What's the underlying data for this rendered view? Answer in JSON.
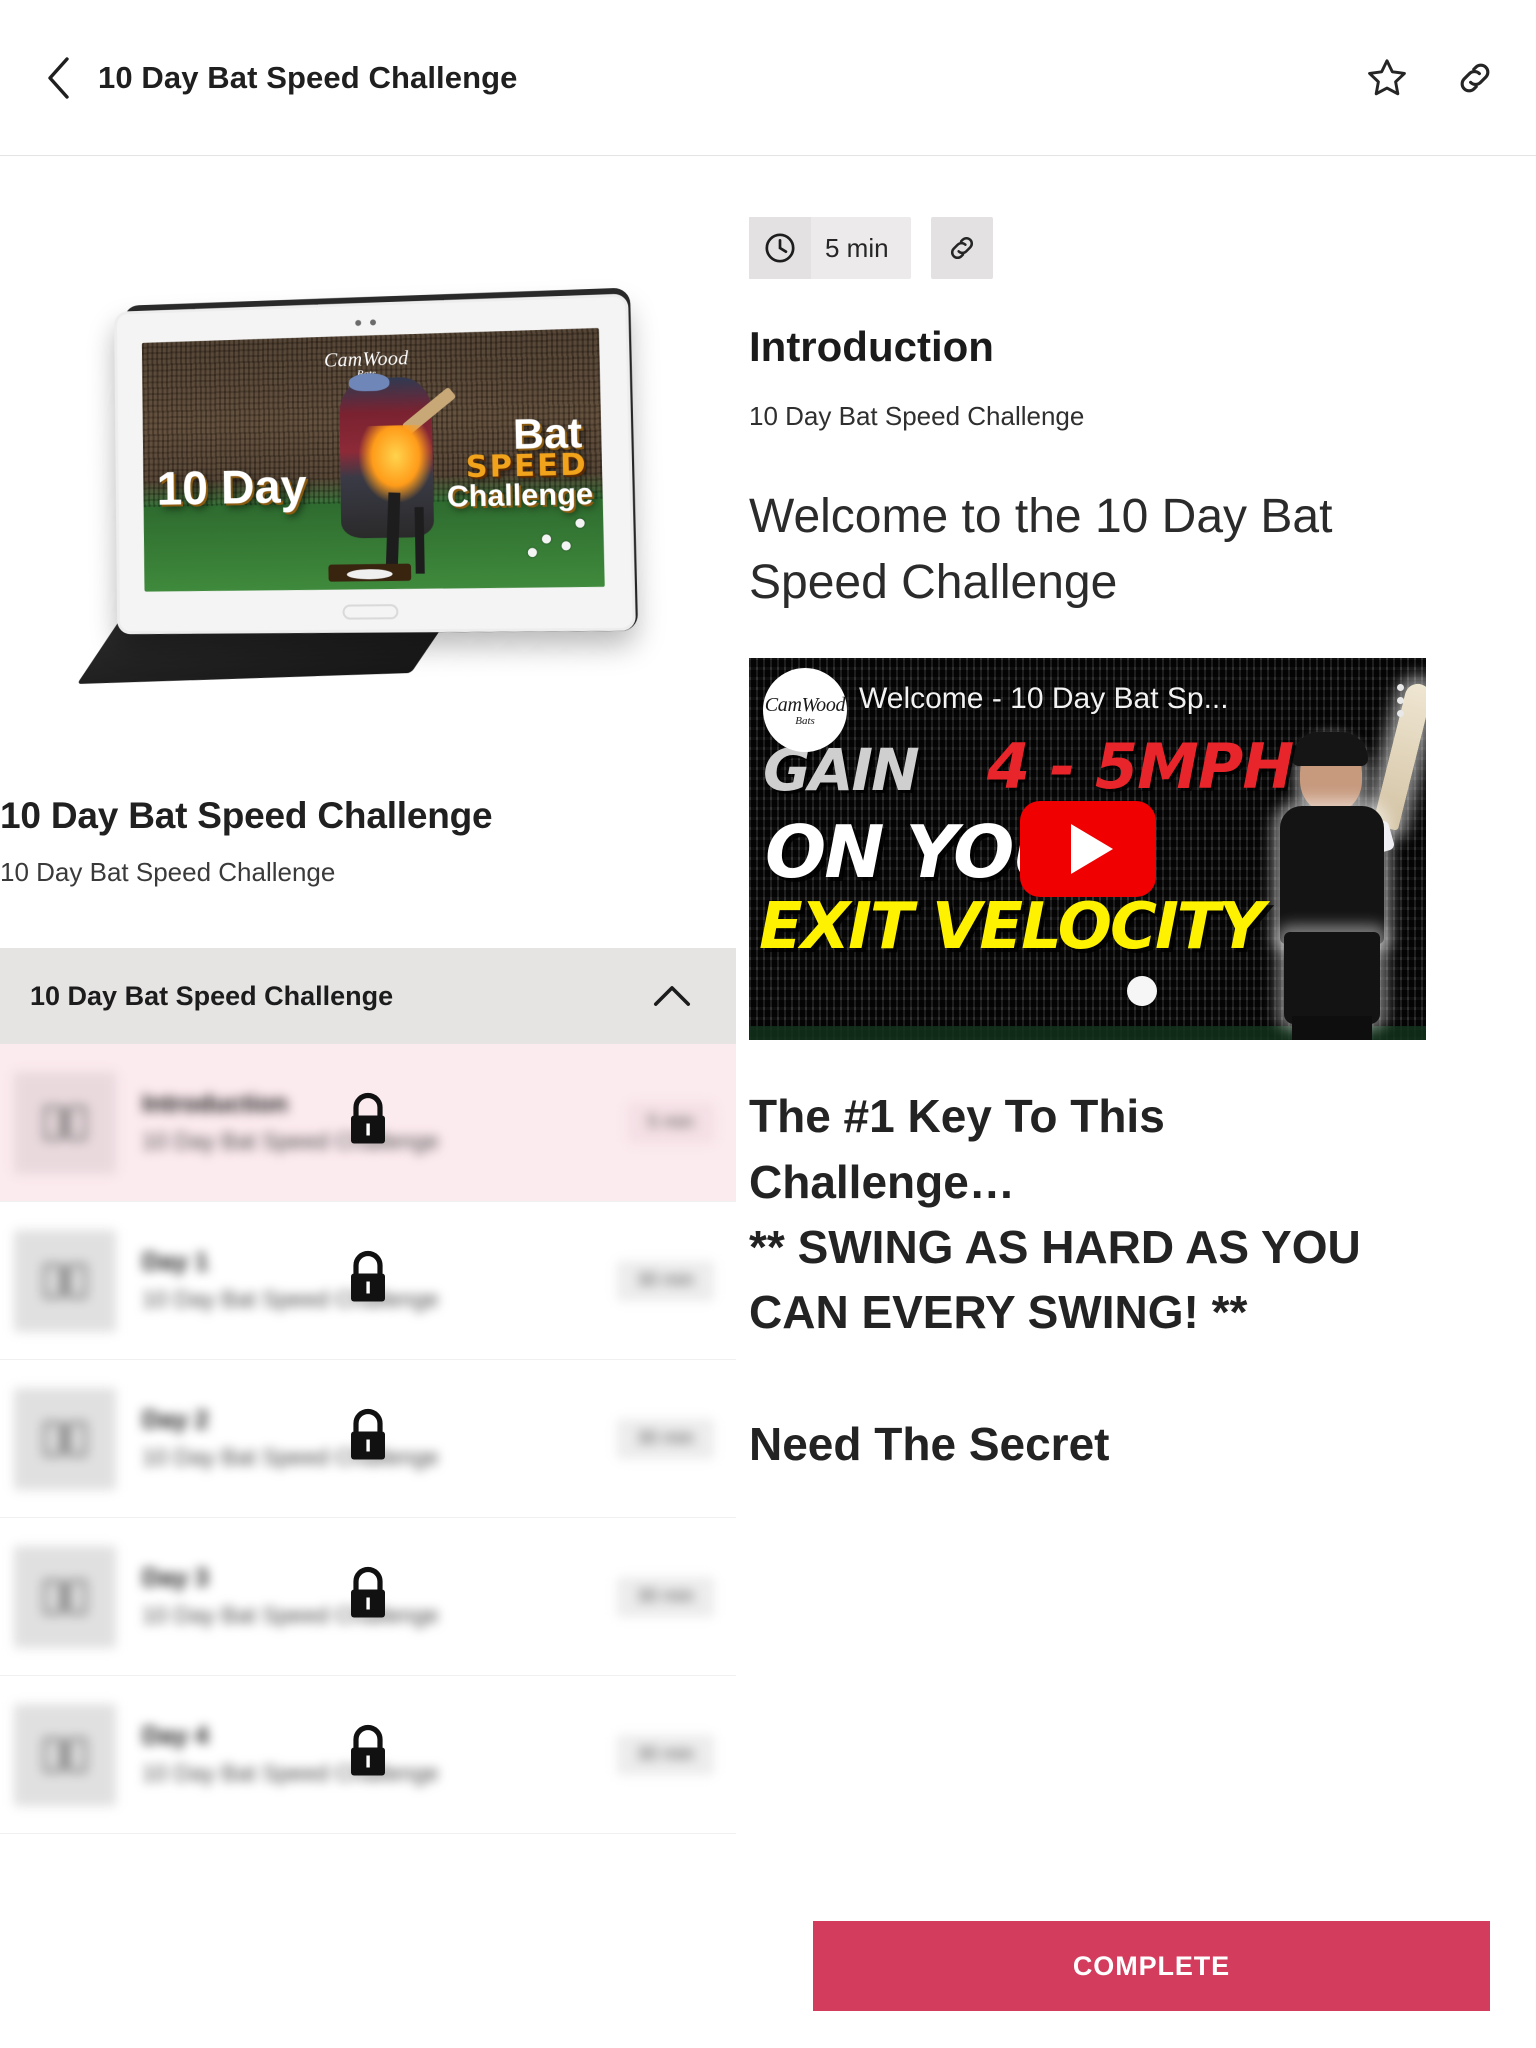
{
  "topbar": {
    "back_icon": "chevron-left-icon",
    "title": "10 Day Bat Speed Challenge",
    "favorite_icon": "star-outline-icon",
    "share_icon": "link-icon"
  },
  "left_panel": {
    "course_image": {
      "device": "tablet",
      "brand_logo_name": "CamWood",
      "brand_logo_sub": "Bats",
      "line1": "10 Day",
      "line2": "Bat",
      "line3": "SPEED",
      "line4": "Challenge"
    },
    "course_title": "10 Day Bat Speed Challenge",
    "course_subtitle": "10 Day Bat Speed Challenge",
    "section": {
      "title": "10 Day Bat Speed Challenge",
      "collapse_icon": "chevron-up-icon",
      "expanded": true
    },
    "lessons": [
      {
        "title": "Introduction",
        "subtitle": "10 Day Bat Speed Challenge",
        "duration": "5 min",
        "locked": true,
        "active": true,
        "icon": "book-icon"
      },
      {
        "title": "Day 1",
        "subtitle": "10 Day Bat Speed Challenge",
        "duration": "30 min",
        "locked": true,
        "active": false,
        "icon": "book-icon"
      },
      {
        "title": "Day 2",
        "subtitle": "10 Day Bat Speed Challenge",
        "duration": "30 min",
        "locked": true,
        "active": false,
        "icon": "book-icon"
      },
      {
        "title": "Day 3",
        "subtitle": "10 Day Bat Speed Challenge",
        "duration": "30 min",
        "locked": true,
        "active": false,
        "icon": "book-icon"
      },
      {
        "title": "Day 4",
        "subtitle": "10 Day Bat Speed Challenge",
        "duration": "30 min",
        "locked": true,
        "active": false,
        "icon": "book-icon"
      }
    ]
  },
  "right_panel": {
    "duration_chip": {
      "icon": "clock-icon",
      "text": "5 min"
    },
    "share_chip": {
      "icon": "link-icon"
    },
    "lesson_title": "Introduction",
    "lesson_course": "10 Day Bat Speed Challenge",
    "welcome_heading": "Welcome to the 10 Day Bat Speed Challenge",
    "video": {
      "channel_logo_name": "CamWood",
      "channel_logo_sub": "Bats",
      "title": "Welcome - 10 Day Bat Sp...",
      "overlay_line1": "GAIN",
      "overlay_line2": "4 - 5MPH",
      "overlay_line3": "ON YOUR",
      "overlay_line4": "EXIT VELOCITY",
      "play_icon": "youtube-play-icon",
      "menu_icon": "kebab-menu-icon"
    },
    "body_heading_1": "The #1 Key To This Challenge…",
    "body_heading_2": "** SWING AS HARD AS YOU CAN EVERY SWING! **",
    "body_heading_3": "Need The Secret",
    "complete_button": "COMPLETE"
  },
  "colors": {
    "accent": "#d43c5e",
    "section_header_bg": "#e6e3e3",
    "active_row_bg": "#fbeaee",
    "chip_bg": "#eceaea",
    "text_primary": "#1d1d1d",
    "youtube_red": "#f00000"
  }
}
